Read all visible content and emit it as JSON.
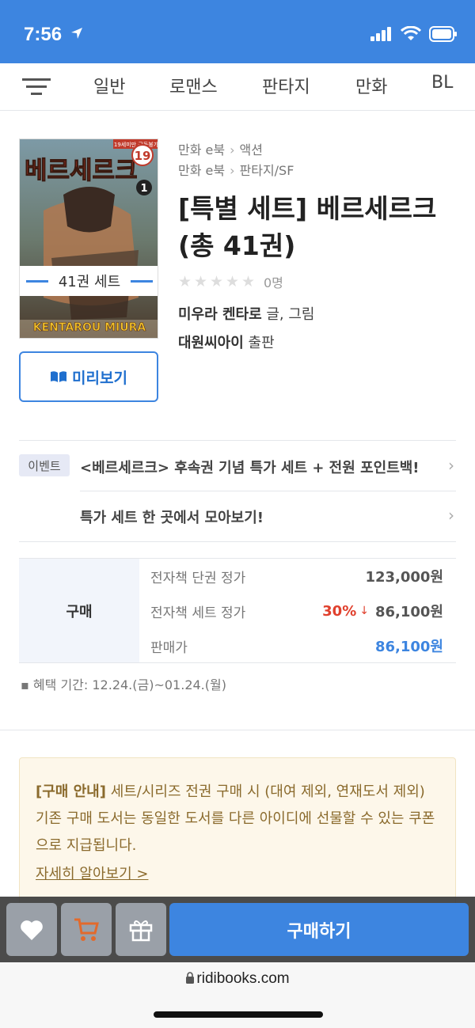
{
  "status": {
    "time": "7:56"
  },
  "nav": {
    "categories": [
      "일반",
      "로맨스",
      "판타지",
      "만화",
      "BL"
    ]
  },
  "book": {
    "cover_top_label": "19세미만 구독불가",
    "cover_volume_badge": "19",
    "cover_volume": "1",
    "cover_title": "베르세르크",
    "cover_author": "KENTAROU MIURA",
    "set_banner": "41권 세트",
    "preview_label": "미리보기",
    "breadcrumbs": [
      {
        "parent": "만화 e북",
        "child": "액션"
      },
      {
        "parent": "만화 e북",
        "child": "판타지/SF"
      }
    ],
    "title": "[특별 세트] 베르세르크 (총 41권)",
    "rating_count": "0명",
    "author_name": "미우라 켄타로",
    "author_role": " 글, 그림",
    "publisher_name": "대원씨아이",
    "publisher_suffix": " 출판"
  },
  "event": {
    "badge": "이벤트",
    "items": [
      "<베르세르크> 후속권 기념 특가 세트 + 전원 포인트백!",
      "특가 세트 한 곳에서 모아보기!"
    ]
  },
  "price": {
    "section_label": "구매",
    "rows": [
      {
        "label": "전자책 단권 정가",
        "value": "123,000원"
      },
      {
        "label": "전자책 세트 정가",
        "discount": "30%",
        "value": "86,100원"
      },
      {
        "label": "판매가",
        "value": "86,100원"
      }
    ],
    "period": "▪ 혜택 기간: 12.24.(금)~01.24.(월)"
  },
  "guide": {
    "highlight": "[구매 안내]",
    "text": " 세트/시리즈 전권 구매 시 (대여 제외, 연재도서 제외) 기존 구매 도서는 동일한 도서를 다른 아이디에 선물할 수 있는 쿠폰으로 지급됩니다.",
    "link": "자세히 알아보기 >"
  },
  "actions": {
    "buy_label": "구매하기"
  },
  "browser": {
    "url": "ridibooks.com"
  },
  "colors": {
    "accent": "#3d85e0",
    "discount": "#e0402d",
    "guide_text": "#8a6a2c"
  }
}
